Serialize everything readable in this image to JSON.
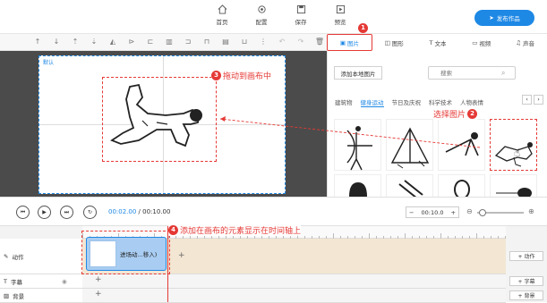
{
  "topnav": [
    {
      "label": "首页",
      "icon": "home-icon"
    },
    {
      "label": "配置",
      "icon": "settings-icon"
    },
    {
      "label": "保存",
      "icon": "save-icon"
    },
    {
      "label": "预览",
      "icon": "preview-icon"
    }
  ],
  "publish_label": "发布作品",
  "right_tabs": [
    {
      "label": "图片",
      "icon": "image-icon"
    },
    {
      "label": "图形",
      "icon": "shape-icon"
    },
    {
      "label": "文本",
      "icon": "text-icon"
    },
    {
      "label": "视频",
      "icon": "video-icon"
    },
    {
      "label": "声音",
      "icon": "sound-icon"
    }
  ],
  "canvas_label": "默认",
  "add_local_image": "添加本地图片",
  "search_placeholder": "搜索",
  "categories": [
    "建筑物",
    "健身运动",
    "节日及庆祝",
    "科学技术",
    "人物表情"
  ],
  "controls": {
    "current_time": "00:02.00",
    "total_time": "/ 00:10.00",
    "zoom_value": "00:10.0"
  },
  "tracks": [
    {
      "label": "动作",
      "add_label": "+ 动作"
    },
    {
      "label": "字幕",
      "add_label": "+ 字幕"
    },
    {
      "label": "背景",
      "add_label": "+ 背景"
    }
  ],
  "clip_label": "进场动...移入)",
  "annotations": {
    "a1": "1",
    "a2_text": "选择图片",
    "a2": "2",
    "a3_text": "拖动到画布中",
    "a3": "3",
    "a4_text": "添加在画布的元素显示在时间轴上",
    "a4": "4"
  },
  "colors": {
    "accent": "#1e88e5",
    "annotation": "#e53935",
    "canvas_bg": "#4b4b4b",
    "clip": "#a9cdf2"
  }
}
